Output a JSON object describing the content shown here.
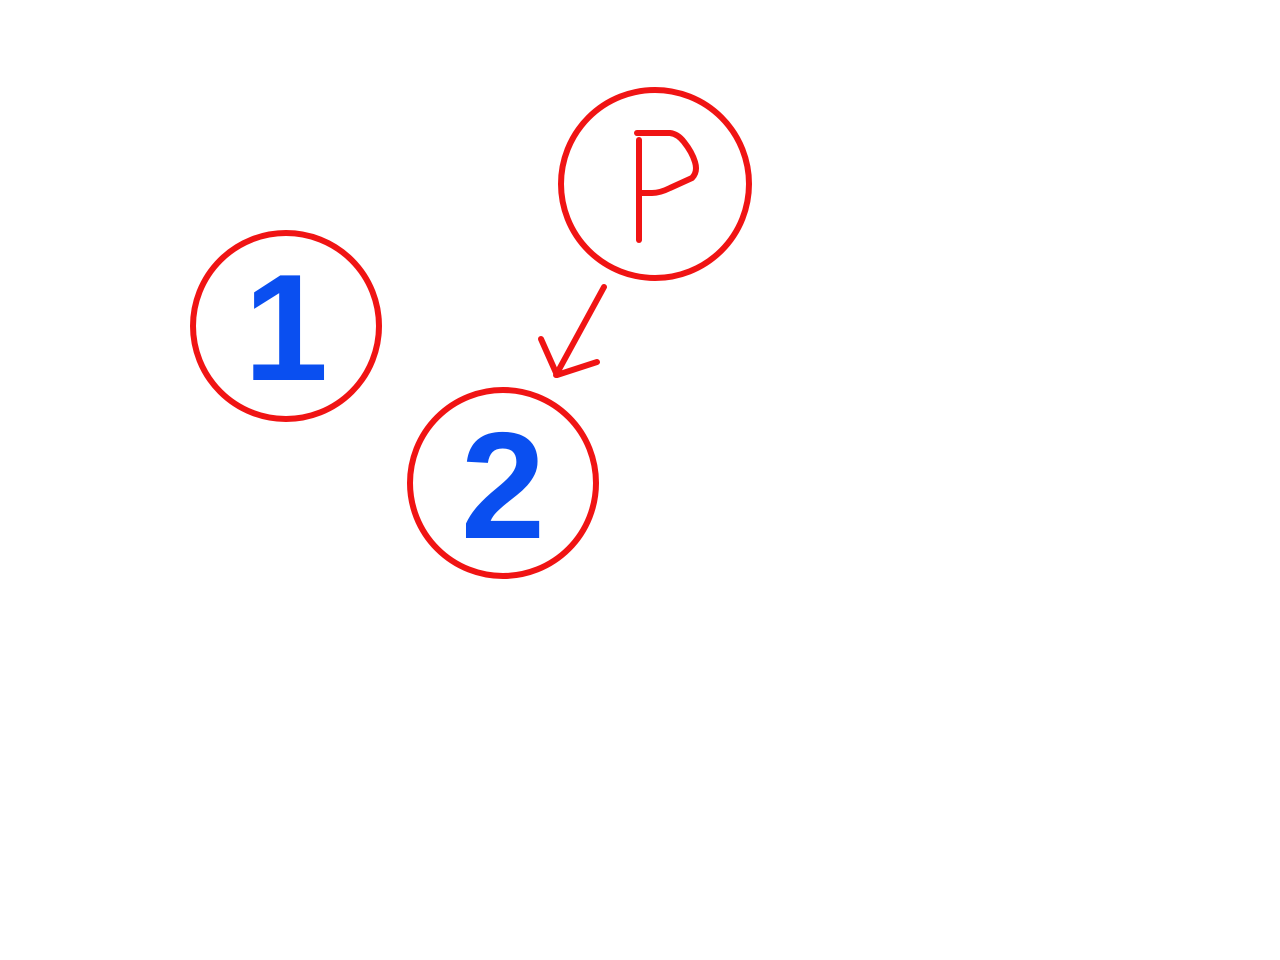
{
  "colors": {
    "background": "#ffffff",
    "circle_stroke": "#f01414",
    "number_fill": "#0a4ff0",
    "arrow_stroke": "#f01414",
    "handwriting_stroke": "#f01414"
  },
  "nodes": [
    {
      "label": "1"
    },
    {
      "label": "2"
    }
  ],
  "pointer_node": {
    "label": "P",
    "style": "handwritten"
  },
  "arrow": {
    "from": "P",
    "to": "2",
    "style": "hand-drawn"
  }
}
